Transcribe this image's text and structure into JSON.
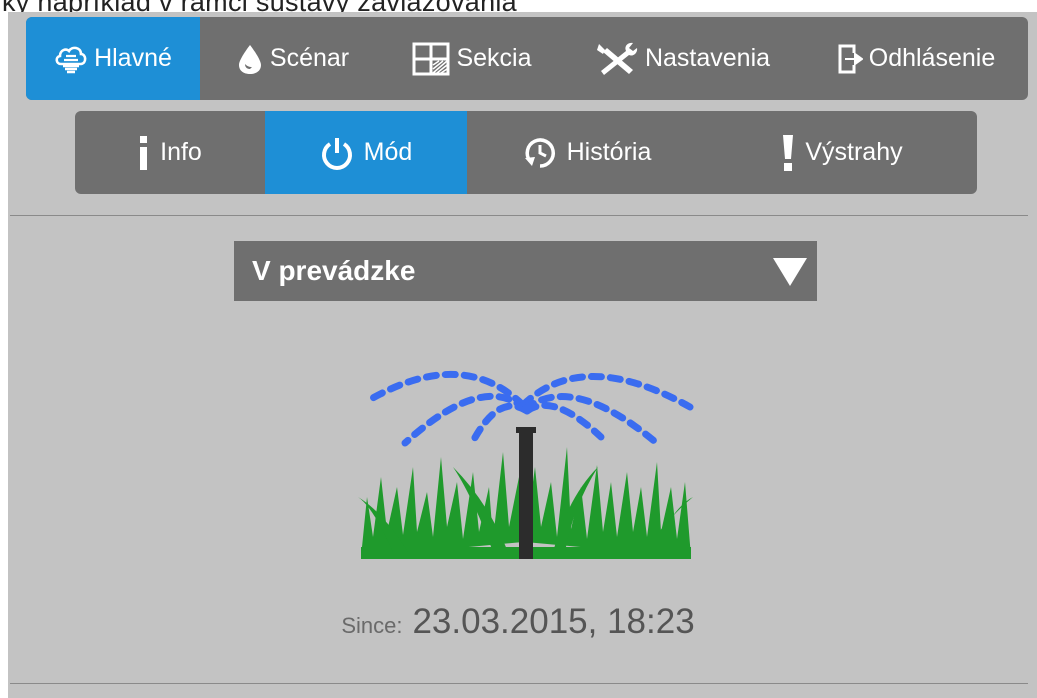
{
  "partial_header_text": "ky napríklad v rámci sústavy zavlažovania",
  "main_nav": {
    "items": [
      {
        "label": "Hlavné",
        "icon": "cloud-sprinkler-icon",
        "active": true
      },
      {
        "label": "Scénar",
        "icon": "water-drop-icon",
        "active": false
      },
      {
        "label": "Sekcia",
        "icon": "section-grid-icon",
        "active": false
      },
      {
        "label": "Nastavenia",
        "icon": "wrench-screwdriver-icon",
        "active": false
      },
      {
        "label": "Odhlásenie",
        "icon": "logout-icon",
        "active": false
      }
    ]
  },
  "sub_nav": {
    "items": [
      {
        "label": "Info",
        "icon": "info-icon",
        "active": false
      },
      {
        "label": "Mód",
        "icon": "power-icon",
        "active": true
      },
      {
        "label": "História",
        "icon": "history-icon",
        "active": false
      },
      {
        "label": "Výstrahy",
        "icon": "exclamation-icon",
        "active": false
      }
    ]
  },
  "mode_select": {
    "value": "V prevádzke",
    "icon": "triangle-down-icon"
  },
  "status": {
    "since_label": "Since:",
    "since_value": "23.03.2015, 18:23",
    "illustration": "sprinkler-on-grass-icon"
  },
  "colors": {
    "accent": "#1e8fd6",
    "nav_bg": "#6f6f6f",
    "panel_bg": "#c3c3c3",
    "water": "#3a6cf0",
    "grass": "#1f9a2c"
  }
}
